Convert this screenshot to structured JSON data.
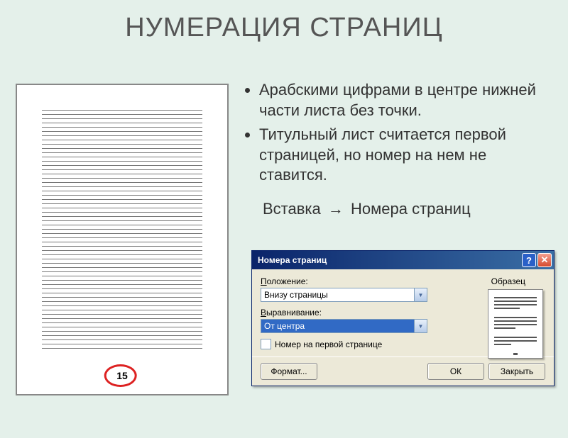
{
  "title": "НУМЕРАЦИЯ СТРАНИЦ",
  "bullets": [
    "Арабскими цифрами в центре нижней части листа без точки.",
    "Титульный лист считается первой страницей, но номер на нем не ставится."
  ],
  "menu_path": {
    "part1": "Вставка",
    "part2": "Номера страниц"
  },
  "page_number": "15",
  "dialog": {
    "title": "Номера страниц",
    "position_label": "Положение:",
    "position_value": "Внизу страницы",
    "align_label": "Выравнивание:",
    "align_value": "От центра",
    "checkbox_label": "Номер на первой странице",
    "sample_label": "Образец",
    "format_btn": "Формат...",
    "ok_btn": "ОК",
    "close_btn": "Закрыть"
  }
}
